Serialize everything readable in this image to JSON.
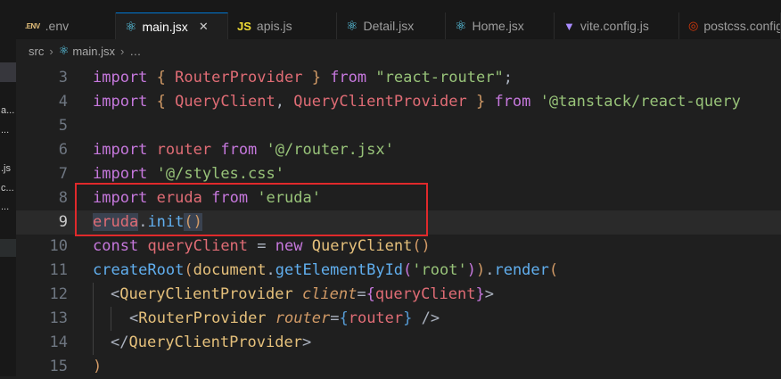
{
  "tabs": [
    {
      "icon": "env-icon",
      "icon_text": ".ENV",
      "label": ".env",
      "active": false
    },
    {
      "icon": "react-icon",
      "icon_text": "⚛",
      "label": "main.jsx",
      "active": true,
      "close": "✕"
    },
    {
      "icon": "js-icon",
      "icon_text": "JS",
      "label": "apis.js",
      "active": false
    },
    {
      "icon": "react-icon",
      "icon_text": "⚛",
      "label": "Detail.jsx",
      "active": false
    },
    {
      "icon": "react-icon",
      "icon_text": "⚛",
      "label": "Home.jsx",
      "active": false
    },
    {
      "icon": "vite-icon",
      "icon_text": "▼",
      "label": "vite.config.js",
      "active": false
    },
    {
      "icon": "postcss-icon",
      "icon_text": "◎",
      "label": "postcss.config",
      "active": false
    }
  ],
  "breadcrumb": {
    "folder": "src",
    "sep": "›",
    "file": "main.jsx",
    "sep2": "›",
    "more": "…"
  },
  "sidebar_fragments": [
    {
      "text": "a..."
    },
    {
      "text": "..."
    },
    {
      "text": ".js"
    },
    {
      "text": "c..."
    },
    {
      "text": "..."
    }
  ],
  "line_numbers": [
    "3",
    "4",
    "5",
    "6",
    "7",
    "8",
    "9",
    "10",
    "11",
    "12",
    "13",
    "14",
    "15"
  ],
  "code": {
    "l3": [
      "import",
      " ",
      "{",
      " RouterProvider ",
      "}",
      " ",
      "from",
      " ",
      "\"react-router\"",
      ";"
    ],
    "l4": [
      "import",
      " ",
      "{",
      " QueryClient",
      ",",
      " QueryClientProvider ",
      "}",
      " ",
      "from",
      " ",
      "'@tanstack/react-query"
    ],
    "l6": [
      "import",
      " ",
      "router",
      " ",
      "from",
      " ",
      "'@/router.jsx'"
    ],
    "l7": [
      "import",
      " ",
      "'@/styles.css'"
    ],
    "l8": [
      "import",
      " ",
      "eruda",
      " ",
      "from",
      " ",
      "'eruda'"
    ],
    "l9": [
      "eruda",
      ".",
      "init",
      "()"
    ],
    "l10": [
      "const",
      " ",
      "queryClient",
      " = ",
      "new",
      " ",
      "QueryClient",
      "()"
    ],
    "l11": [
      "createRoot",
      "(",
      "document",
      ".",
      "getElementById",
      "(",
      "'root'",
      ")",
      ")",
      ".",
      "render",
      "("
    ],
    "l12": [
      "<",
      "QueryClientProvider",
      " ",
      "client",
      "=",
      "{",
      "queryClient",
      "}",
      ">"
    ],
    "l13": [
      "<",
      "RouterProvider",
      " ",
      "router",
      "=",
      "{",
      "router",
      "}",
      " />"
    ],
    "l14": [
      "</",
      "QueryClientProvider",
      ">"
    ],
    "l15": [
      ")"
    ]
  }
}
